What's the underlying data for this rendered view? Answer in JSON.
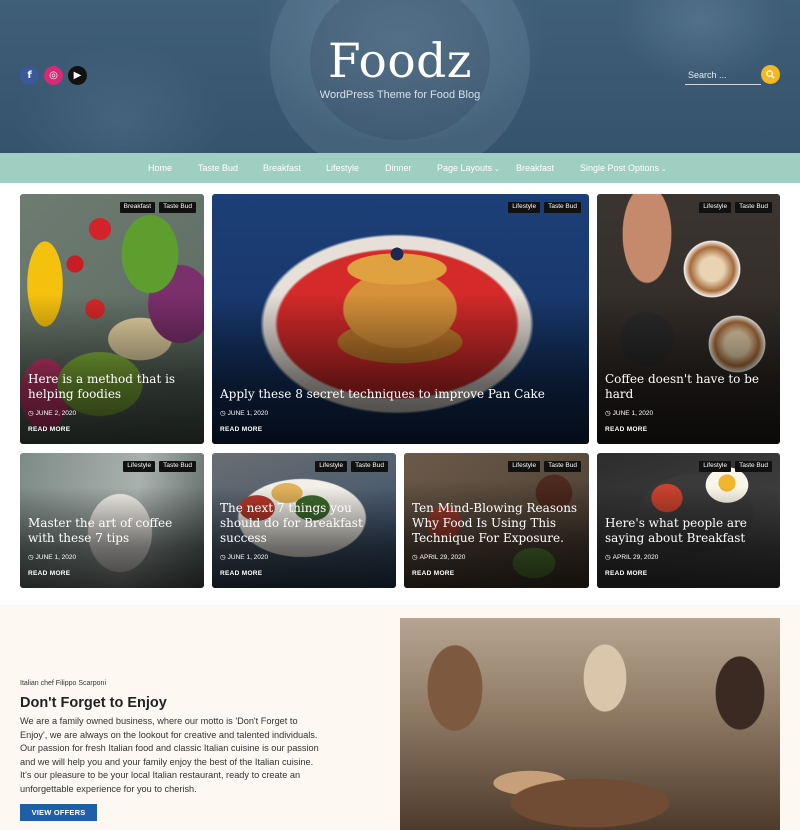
{
  "header": {
    "site_title": "Foodz",
    "tagline": "WordPress Theme for Food Blog",
    "search_placeholder": "Search ...",
    "social": [
      {
        "name": "facebook-icon",
        "glyph": "f"
      },
      {
        "name": "instagram-icon",
        "glyph": "◎"
      },
      {
        "name": "youtube-icon",
        "glyph": "▶"
      }
    ],
    "accent": "#f2b81e"
  },
  "nav": {
    "items": [
      {
        "label": "Home"
      },
      {
        "label": "Taste Bud"
      },
      {
        "label": "Breakfast"
      },
      {
        "label": "Lifestyle"
      },
      {
        "label": "Dinner"
      },
      {
        "label": "Page Layouts",
        "dropdown": true
      },
      {
        "label": "Breakfast"
      },
      {
        "label": "Single Post Options",
        "dropdown": true
      }
    ],
    "background": "#9fcfc0"
  },
  "posts": [
    {
      "tags": [
        "Breakfast",
        "Taste Bud"
      ],
      "title": "Here is a method that is helping foodies",
      "date": "JUNE 2, 2020",
      "more": "READ MORE"
    },
    {
      "tags": [
        "Lifestyle",
        "Taste Bud"
      ],
      "title": "Apply these 8 secret techniques to improve Pan Cake",
      "date": "JUNE 1, 2020",
      "more": "READ MORE"
    },
    {
      "tags": [
        "Lifestyle",
        "Taste Bud"
      ],
      "title": "Coffee doesn't have to be hard",
      "date": "JUNE 1, 2020",
      "more": "READ MORE"
    },
    {
      "tags": [
        "Lifestyle",
        "Taste Bud"
      ],
      "title": "Master the art of coffee with these 7 tips",
      "date": "JUNE 1, 2020",
      "more": "READ MORE"
    },
    {
      "tags": [
        "Lifestyle",
        "Taste Bud"
      ],
      "title": "The next 7 things you should do for Breakfast success",
      "date": "JUNE 1, 2020",
      "more": "READ MORE"
    },
    {
      "tags": [
        "Lifestyle",
        "Taste Bud"
      ],
      "title": "Ten Mind-Blowing Reasons Why Food Is Using This Technique For Exposure.",
      "date": "APRIL 29, 2020",
      "more": "READ MORE"
    },
    {
      "tags": [
        "Lifestyle",
        "Taste Bud"
      ],
      "title": "Here's what people are saying about Breakfast",
      "date": "APRIL 29, 2020",
      "more": "READ MORE"
    }
  ],
  "about": {
    "eyebrow": "Italian chef Filippo Scarponi",
    "heading": "Don't Forget to Enjoy",
    "body": "We are a family owned business, where our motto is 'Don't Forget to Enjoy', we are always on the lookout for creative and talented individuals. Our passion for fresh Italian food and classic Italian cuisine is our passion and we will help you and your family enjoy the best of the Italian cuisine. It's our pleasure to be your local Italian restaurant, ready to create an unforgettable experience for you to cherish.",
    "cta": "VIEW OFFERS",
    "cta_color": "#1f5fa8"
  }
}
